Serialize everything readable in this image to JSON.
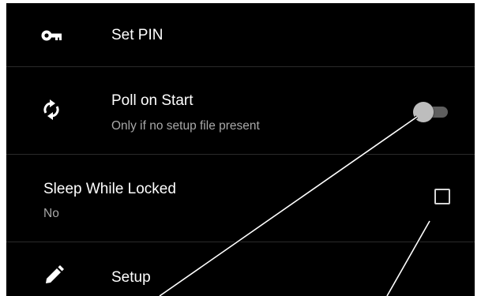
{
  "settings": {
    "set_pin": {
      "title": "Set PIN",
      "icon": "key-icon"
    },
    "poll_on_start": {
      "title": "Poll on Start",
      "subtitle": "Only if no setup file present",
      "icon": "sync-icon",
      "toggle_on": false
    },
    "sleep_while_locked": {
      "title": "Sleep While Locked",
      "subtitle": "No",
      "checked": false
    },
    "setup": {
      "title": "Setup",
      "icon": "pencil-icon"
    }
  },
  "colors": {
    "background": "#000000",
    "title_text": "#ffffff",
    "subtitle_text": "#a8a8a8",
    "divider": "#2a2a2a",
    "callout_line": "#ffffff"
  }
}
